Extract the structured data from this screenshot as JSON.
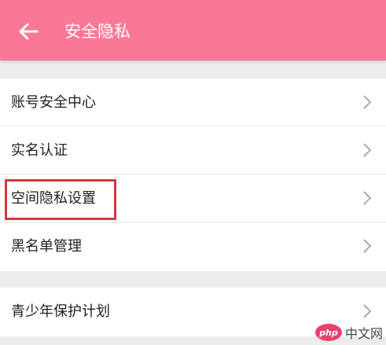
{
  "header": {
    "title": "安全隐私",
    "back_icon": "arrow-left-icon",
    "background": "#f97896"
  },
  "groups": [
    {
      "items": [
        {
          "label": "账号安全中心"
        },
        {
          "label": "实名认证"
        },
        {
          "label": "空间隐私设置"
        },
        {
          "label": "黑名单管理"
        }
      ]
    },
    {
      "items": [
        {
          "label": "青少年保护计划"
        }
      ]
    }
  ],
  "watermark": {
    "logo": "php",
    "text": "中文网"
  },
  "colors": {
    "accent": "#f97896",
    "highlight": "#cf3b3b"
  }
}
